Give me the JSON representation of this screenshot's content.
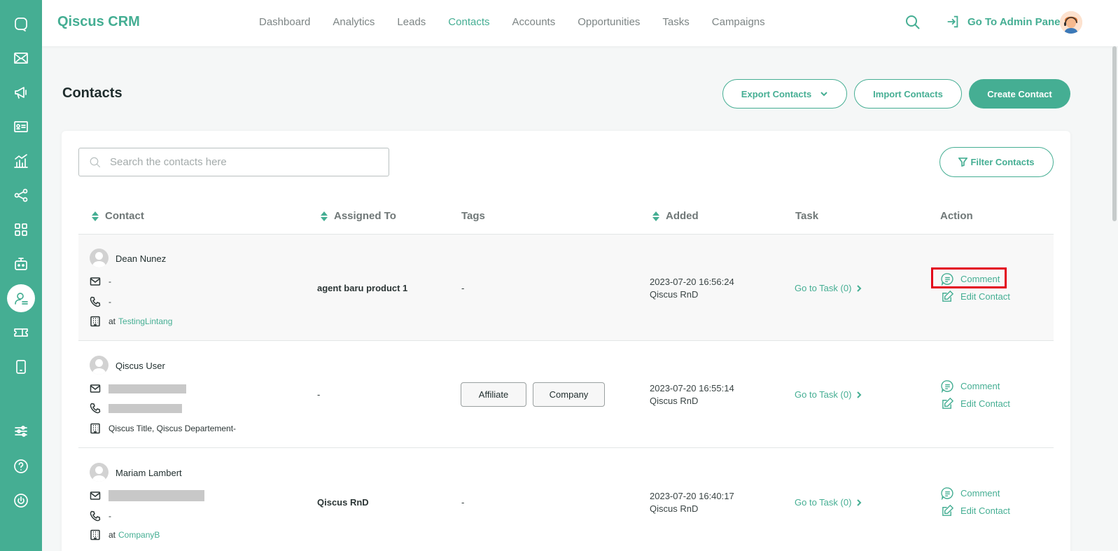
{
  "brand": "Qiscus CRM",
  "nav": [
    "Dashboard",
    "Analytics",
    "Leads",
    "Contacts",
    "Accounts",
    "Opportunities",
    "Tasks",
    "Campaigns"
  ],
  "nav_active": "Contacts",
  "admin_link": "Go To Admin Panel",
  "page_title": "Contacts",
  "buttons": {
    "export": "Export Contacts",
    "import": "Import Contacts",
    "create": "Create Contact",
    "filter": "Filter Contacts"
  },
  "search": {
    "placeholder": "Search the contacts here"
  },
  "columns": {
    "contact": "Contact",
    "assigned": "Assigned To",
    "tags": "Tags",
    "added": "Added",
    "task": "Task",
    "action": "Action"
  },
  "rows": [
    {
      "name": "Dean Nunez",
      "email": "-",
      "phone": "-",
      "company_prefix": "at",
      "company": "TestingLintang",
      "assigned": "agent baru product 1",
      "tags_text": "-",
      "added_date": "2023-07-20 16:56:24",
      "added_by": "Qiscus RnD",
      "task": "Go to Task (0)",
      "comment": "Comment",
      "edit": "Edit Contact"
    },
    {
      "name": "Qiscus User",
      "company_text": "Qiscus Title, Qiscus Departement-",
      "assigned": "-",
      "tags": [
        "Affiliate",
        "Company"
      ],
      "added_date": "2023-07-20 16:55:14",
      "added_by": "Qiscus RnD",
      "task": "Go to Task (0)",
      "comment": "Comment",
      "edit": "Edit Contact"
    },
    {
      "name": "Mariam Lambert",
      "phone": "-",
      "company_prefix": "at",
      "company": "CompanyB",
      "assigned": "Qiscus RnD",
      "tags_text": "-",
      "added_date": "2023-07-20 16:40:17",
      "added_by": "Qiscus RnD",
      "task": "Go to Task (0)",
      "comment": "Comment",
      "edit": "Edit Contact"
    }
  ],
  "colors": {
    "primary": "#45ae93",
    "highlight": "#e3001b"
  }
}
